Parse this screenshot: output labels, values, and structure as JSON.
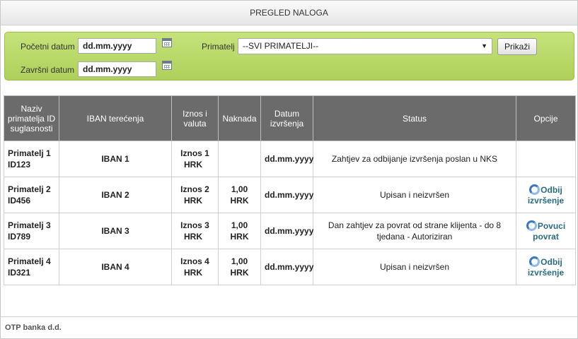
{
  "header": {
    "title": "PREGLED NALOGA"
  },
  "filter": {
    "start_label": "Početni datum",
    "start_value": "dd.mm.yyyy",
    "end_label": "Završni datum",
    "end_value": "dd.mm.yyyy",
    "recipient_label": "Primatelj",
    "recipient_selected": "--SVI PRIMATELJI--",
    "show_button": "Prikaži"
  },
  "table": {
    "columns": [
      "Naziv primatelja ID suglasnosti",
      "IBAN terećenja",
      "Iznos i valuta",
      "Naknada",
      "Datum izvršenja",
      "Status",
      "Opcije"
    ],
    "rows": [
      {
        "name": "Primatelj 1",
        "id": "ID123",
        "iban": "IBAN 1",
        "amount": "Iznos 1",
        "currency": "HRK",
        "fee": "",
        "fee_currency": "",
        "date": "dd.mm.yyyy",
        "status": "Zahtjev za odbijanje izvršenja poslan u NKS",
        "option_line1": "",
        "option_line2": ""
      },
      {
        "name": "Primatelj 2",
        "id": "ID456",
        "iban": "IBAN 2",
        "amount": "Iznos 2",
        "currency": "HRK",
        "fee": "1,00",
        "fee_currency": "HRK",
        "date": "dd.mm.yyyy",
        "status": "Upisan i neizvršen",
        "option_line1": "Odbij",
        "option_line2": "izvršenje"
      },
      {
        "name": "Primatelj 3",
        "id": "ID789",
        "iban": "IBAN 3",
        "amount": "Iznos 3",
        "currency": "HRK",
        "fee": "1,00",
        "fee_currency": "HRK",
        "date": "dd.mm.yyyy",
        "status": "Dan zahtjev za povrat od strane klijenta - do 8 tjedana - Autoriziran",
        "option_line1": "Povuci",
        "option_line2": "povrat"
      },
      {
        "name": "Primatelj 4",
        "id": "ID321",
        "iban": "IBAN 4",
        "amount": "Iznos 4",
        "currency": "HRK",
        "fee": "1,00",
        "fee_currency": "HRK",
        "date": "dd.mm.yyyy",
        "status": "Upisan i neizvršen",
        "option_line1": "Odbij",
        "option_line2": "izvršenje"
      }
    ]
  },
  "footer": {
    "text": "OTP banka d.d."
  },
  "icons": {
    "calendar": "calendar-icon",
    "refresh": "refresh-icon",
    "dropdown": "chevron-down-icon"
  }
}
